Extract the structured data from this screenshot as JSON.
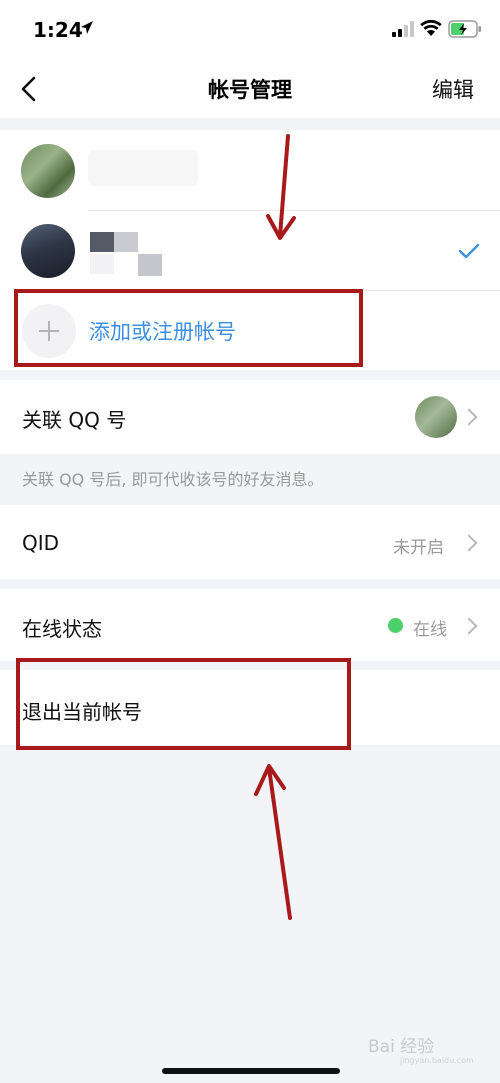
{
  "status_bar": {
    "time": "1:24"
  },
  "nav": {
    "title": "帐号管理",
    "edit_label": "编辑"
  },
  "accounts": {
    "add_label": "添加或注册帐号"
  },
  "linked_qq": {
    "label": "关联 QQ 号",
    "hint": "关联 QQ 号后, 即可代收该号的好友消息。"
  },
  "qid": {
    "label": "QID",
    "value": "未开启"
  },
  "online_status": {
    "label": "在线状态",
    "value": "在线",
    "dot_color": "#4ed06a"
  },
  "logout": {
    "label": "退出当前帐号"
  },
  "annotation": {
    "color": "#a81a1a"
  },
  "watermark": {
    "text": "Bai 经验",
    "sub": "jingyan.baidu.com"
  },
  "colors": {
    "accent": "#3d8fe0",
    "background": "#f3f4f7"
  }
}
